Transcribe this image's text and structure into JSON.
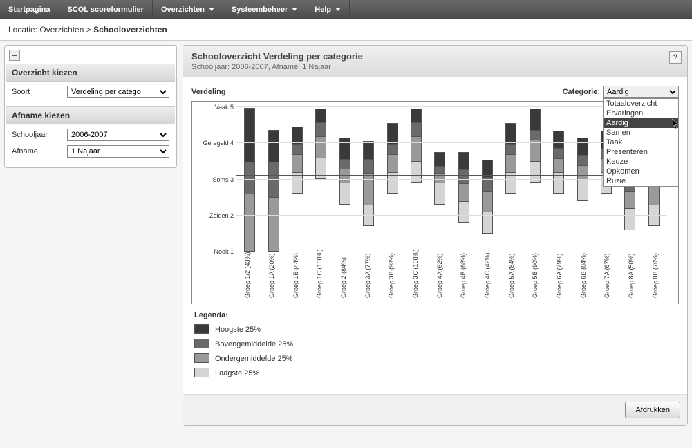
{
  "nav": {
    "items": [
      {
        "label": "Startpagina",
        "dd": false
      },
      {
        "label": "SCOL scoreformulier",
        "dd": false
      },
      {
        "label": "Overzichten",
        "dd": true
      },
      {
        "label": "Systeembeheer",
        "dd": true
      },
      {
        "label": "Help",
        "dd": true
      }
    ]
  },
  "breadcrumb": {
    "prefix": "Locatie: Overzichten > ",
    "current": "Schooloverzichten"
  },
  "sidebar": {
    "panel1": {
      "title": "Overzicht kiezen",
      "soort_label": "Soort",
      "soort_value": "Verdeling per catego"
    },
    "panel2": {
      "title": "Afname kiezen",
      "schooljaar_label": "Schooljaar",
      "schooljaar_value": "2006-2007",
      "afname_label": "Afname",
      "afname_value": "1 Najaar"
    }
  },
  "main": {
    "title": "Schooloverzicht Verdeling per categorie",
    "subtitle": "Schooljaar: 2006-2007, Afname: 1 Najaar",
    "help": "?",
    "chart_label": "Verdeling",
    "categorie_label": "Categorie:",
    "categorie_selected": "Aardig",
    "categorie_options": [
      "Totaaloverzicht",
      "Ervaringen",
      "Aardig",
      "Samen",
      "Taak",
      "Presenteren",
      "Keuze",
      "Opkomen",
      "Ruzie"
    ],
    "ylabels": [
      "Vaak 5",
      "Geregeld 4",
      "Soms 3",
      "Zelden 2",
      "Nooit 1"
    ],
    "legend_title": "Legenda:",
    "legend": [
      {
        "label": "Hoogste 25%",
        "cls": "q4"
      },
      {
        "label": "Bovengemiddelde 25%",
        "cls": "q3"
      },
      {
        "label": "Ondergemiddelde 25%",
        "cls": "q2"
      },
      {
        "label": "Laagste 25%",
        "cls": "q1"
      }
    ],
    "print_label": "Afdrukken"
  },
  "chart_data": {
    "type": "bar",
    "title": "Verdeling",
    "ylabel": "",
    "xlabel": "",
    "ylim": [
      1,
      5
    ],
    "yref": 3.1,
    "ytick_labels": [
      "Nooit 1",
      "Zelden 2",
      "Soms 3",
      "Geregeld 4",
      "Vaak 5"
    ],
    "categories": [
      "Groep 1/2 (43%)",
      "Groep 1A (20%)",
      "Groep 1B (44%)",
      "Groep 1C (100%)",
      "Groep 2 (84%)",
      "Groep 3A (77%)",
      "Groep 3B (93%)",
      "Groep 3C (100%)",
      "Groep 4A (62%)",
      "Groep 4B (68%)",
      "Groep 4C (42%)",
      "Groep 5A (84%)",
      "Groep 5B (90%)",
      "Groep 6A (79%)",
      "Groep 6B (84%)",
      "Groep 7A (67%)",
      "Groep 8A (50%)",
      "Groep 8B (70%)"
    ],
    "series": [
      {
        "name": "q1_low",
        "values": [
          1.0,
          1.0,
          3.2,
          3.6,
          2.9,
          2.3,
          3.2,
          3.5,
          2.9,
          2.4,
          2.1,
          3.2,
          3.5,
          3.2,
          3.0,
          3.2,
          2.2,
          2.3
        ]
      },
      {
        "name": "q2_low",
        "values": [
          2.6,
          2.5,
          3.7,
          4.2,
          3.3,
          3.2,
          3.7,
          4.2,
          3.2,
          2.9,
          2.7,
          3.7,
          4.1,
          3.6,
          3.4,
          3.6,
          2.7,
          2.9
        ]
      },
      {
        "name": "q3_low",
        "values": [
          3.5,
          3.5,
          4.0,
          4.6,
          3.6,
          3.6,
          4.0,
          4.6,
          3.4,
          3.3,
          3.1,
          4.0,
          4.4,
          3.9,
          3.7,
          3.9,
          3.1,
          3.3
        ]
      },
      {
        "name": "q4_high",
        "values": [
          5.0,
          4.4,
          4.5,
          5.0,
          4.2,
          4.1,
          4.6,
          5.0,
          3.8,
          3.8,
          3.6,
          4.6,
          5.0,
          4.4,
          4.2,
          4.4,
          3.7,
          3.9
        ]
      }
    ]
  }
}
